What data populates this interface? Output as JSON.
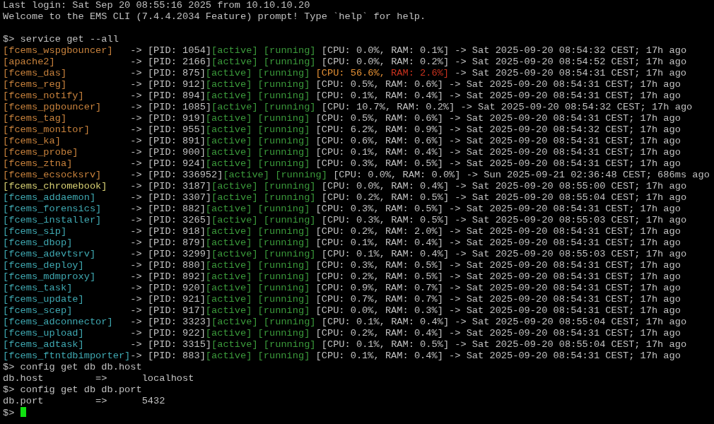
{
  "login_message": "Last login: Sat Sep 20 08:55:16 2025 from 10.10.10.20",
  "welcome_message": "Welcome to the EMS CLI (7.4.4.2034 Feature) prompt! Type `help` for help.",
  "service_command": "$> service get --all",
  "services": [
    {
      "name": "[fcems_wspgbouncer]",
      "color": "#c8823c",
      "arrow": "->",
      "pid": "[PID: 1054]",
      "active": "[active]",
      "running": "[running]",
      "cpu": "[CPU: 0.0%,",
      "ram": "RAM: 0.1%]",
      "cpu_warning": false,
      "ram_critical": false,
      "since": "-> Sat 2025-09-20 08:54:32 CEST; 17h ago"
    },
    {
      "name": "[apache2]",
      "color": "#c8823c",
      "arrow": "->",
      "pid": "[PID: 2166]",
      "active": "[active]",
      "running": "[running]",
      "cpu": "[CPU: 0.0%,",
      "ram": "RAM: 0.2%]",
      "cpu_warning": false,
      "ram_critical": false,
      "since": "-> Sat 2025-09-20 08:54:52 CEST; 17h ago"
    },
    {
      "name": "[fcems_das]",
      "color": "#c8823c",
      "arrow": "->",
      "pid": "[PID: 875]",
      "active": "[active]",
      "running": "[running]",
      "cpu": "[CPU: 56.6%,",
      "ram": "RAM: 2.6%]",
      "cpu_warning": true,
      "ram_critical": true,
      "since": "-> Sat 2025-09-20 08:54:31 CEST; 17h ago"
    },
    {
      "name": "[fcems_reg]",
      "color": "#c8823c",
      "arrow": "->",
      "pid": "[PID: 912]",
      "active": "[active]",
      "running": "[running]",
      "cpu": "[CPU: 0.5%,",
      "ram": "RAM: 0.6%]",
      "cpu_warning": false,
      "ram_critical": false,
      "since": "-> Sat 2025-09-20 08:54:31 CEST; 17h ago"
    },
    {
      "name": "[fcems_notify]",
      "color": "#c8823c",
      "arrow": "->",
      "pid": "[PID: 894]",
      "active": "[active]",
      "running": "[running]",
      "cpu": "[CPU: 0.1%,",
      "ram": "RAM: 0.4%]",
      "cpu_warning": false,
      "ram_critical": false,
      "since": "-> Sat 2025-09-20 08:54:31 CEST; 17h ago"
    },
    {
      "name": "[fcems_pgbouncer]",
      "color": "#c8823c",
      "arrow": "->",
      "pid": "[PID: 1085]",
      "active": "[active]",
      "running": "[running]",
      "cpu": "[CPU: 10.7%,",
      "ram": "RAM: 0.2%]",
      "cpu_warning": false,
      "ram_critical": false,
      "since": "-> Sat 2025-09-20 08:54:32 CEST; 17h ago"
    },
    {
      "name": "[fcems_tag]",
      "color": "#c8823c",
      "arrow": "->",
      "pid": "[PID: 919]",
      "active": "[active]",
      "running": "[running]",
      "cpu": "[CPU: 0.5%,",
      "ram": "RAM: 0.6%]",
      "cpu_warning": false,
      "ram_critical": false,
      "since": "-> Sat 2025-09-20 08:54:31 CEST; 17h ago"
    },
    {
      "name": "[fcems_monitor]",
      "color": "#c8823c",
      "arrow": "->",
      "pid": "[PID: 955]",
      "active": "[active]",
      "running": "[running]",
      "cpu": "[CPU: 6.2%,",
      "ram": "RAM: 0.9%]",
      "cpu_warning": false,
      "ram_critical": false,
      "since": "-> Sat 2025-09-20 08:54:32 CEST; 17h ago"
    },
    {
      "name": "[fcems_ka]",
      "color": "#c8823c",
      "arrow": "->",
      "pid": "[PID: 891]",
      "active": "[active]",
      "running": "[running]",
      "cpu": "[CPU: 0.6%,",
      "ram": "RAM: 0.6%]",
      "cpu_warning": false,
      "ram_critical": false,
      "since": "-> Sat 2025-09-20 08:54:31 CEST; 17h ago"
    },
    {
      "name": "[fcems_probe]",
      "color": "#c8823c",
      "arrow": "->",
      "pid": "[PID: 900]",
      "active": "[active]",
      "running": "[running]",
      "cpu": "[CPU: 0.1%,",
      "ram": "RAM: 0.4%]",
      "cpu_warning": false,
      "ram_critical": false,
      "since": "-> Sat 2025-09-20 08:54:31 CEST; 17h ago"
    },
    {
      "name": "[fcems_ztna]",
      "color": "#c8823c",
      "arrow": "->",
      "pid": "[PID: 924]",
      "active": "[active]",
      "running": "[running]",
      "cpu": "[CPU: 0.3%,",
      "ram": "RAM: 0.5%]",
      "cpu_warning": false,
      "ram_critical": false,
      "since": "-> Sat 2025-09-20 08:54:31 CEST; 17h ago"
    },
    {
      "name": "[fcems_ecsocksrv]",
      "color": "#c8823c",
      "arrow": "->",
      "pid": "[PID: 336952]",
      "active": "[active]",
      "running": "[running]",
      "cpu": "[CPU: 0.0%,",
      "ram": "RAM: 0.0%]",
      "cpu_warning": false,
      "ram_critical": false,
      "since": "-> Sun 2025-09-21 02:36:48 CEST; 686ms ago"
    },
    {
      "name": "[fcems_chromebook]",
      "color": "#d6cf72",
      "arrow": "->",
      "pid": "[PID: 3187]",
      "active": "[active]",
      "running": "[running]",
      "cpu": "[CPU: 0.0%,",
      "ram": "RAM: 0.4%]",
      "cpu_warning": false,
      "ram_critical": false,
      "since": "-> Sat 2025-09-20 08:55:00 CEST; 17h ago"
    },
    {
      "name": "[fcems_addaemon]",
      "color": "#3fa9b2",
      "arrow": "->",
      "pid": "[PID: 3307]",
      "active": "[active]",
      "running": "[running]",
      "cpu": "[CPU: 0.2%,",
      "ram": "RAM: 0.5%]",
      "cpu_warning": false,
      "ram_critical": false,
      "since": "-> Sat 2025-09-20 08:55:04 CEST; 17h ago"
    },
    {
      "name": "[fcems_forensics]",
      "color": "#3fa9b2",
      "arrow": "->",
      "pid": "[PID: 882]",
      "active": "[active]",
      "running": "[running]",
      "cpu": "[CPU: 0.3%,",
      "ram": "RAM: 0.5%]",
      "cpu_warning": false,
      "ram_critical": false,
      "since": "-> Sat 2025-09-20 08:54:31 CEST; 17h ago"
    },
    {
      "name": "[fcems_installer]",
      "color": "#3fa9b2",
      "arrow": "->",
      "pid": "[PID: 3265]",
      "active": "[active]",
      "running": "[running]",
      "cpu": "[CPU: 0.3%,",
      "ram": "RAM: 0.5%]",
      "cpu_warning": false,
      "ram_critical": false,
      "since": "-> Sat 2025-09-20 08:55:03 CEST; 17h ago"
    },
    {
      "name": "[fcems_sip]",
      "color": "#3fa9b2",
      "arrow": "->",
      "pid": "[PID: 918]",
      "active": "[active]",
      "running": "[running]",
      "cpu": "[CPU: 0.2%,",
      "ram": "RAM: 2.0%]",
      "cpu_warning": false,
      "ram_critical": false,
      "since": "-> Sat 2025-09-20 08:54:31 CEST; 17h ago"
    },
    {
      "name": "[fcems_dbop]",
      "color": "#3fa9b2",
      "arrow": "->",
      "pid": "[PID: 879]",
      "active": "[active]",
      "running": "[running]",
      "cpu": "[CPU: 0.1%,",
      "ram": "RAM: 0.4%]",
      "cpu_warning": false,
      "ram_critical": false,
      "since": "-> Sat 2025-09-20 08:54:31 CEST; 17h ago"
    },
    {
      "name": "[fcems_adevtsrv]",
      "color": "#3fa9b2",
      "arrow": "->",
      "pid": "[PID: 3299]",
      "active": "[active]",
      "running": "[running]",
      "cpu": "[CPU: 0.1%,",
      "ram": "RAM: 0.4%]",
      "cpu_warning": false,
      "ram_critical": false,
      "since": "-> Sat 2025-09-20 08:55:03 CEST; 17h ago"
    },
    {
      "name": "[fcems_deploy]",
      "color": "#3fa9b2",
      "arrow": "->",
      "pid": "[PID: 880]",
      "active": "[active]",
      "running": "[running]",
      "cpu": "[CPU: 0.3%,",
      "ram": "RAM: 0.5%]",
      "cpu_warning": false,
      "ram_critical": false,
      "since": "-> Sat 2025-09-20 08:54:31 CEST; 17h ago"
    },
    {
      "name": "[fcems_mdmproxy]",
      "color": "#3fa9b2",
      "arrow": "->",
      "pid": "[PID: 892]",
      "active": "[active]",
      "running": "[running]",
      "cpu": "[CPU: 0.2%,",
      "ram": "RAM: 0.5%]",
      "cpu_warning": false,
      "ram_critical": false,
      "since": "-> Sat 2025-09-20 08:54:31 CEST; 17h ago"
    },
    {
      "name": "[fcems_task]",
      "color": "#3fa9b2",
      "arrow": "->",
      "pid": "[PID: 920]",
      "active": "[active]",
      "running": "[running]",
      "cpu": "[CPU: 0.9%,",
      "ram": "RAM: 0.7%]",
      "cpu_warning": false,
      "ram_critical": false,
      "since": "-> Sat 2025-09-20 08:54:31 CEST; 17h ago"
    },
    {
      "name": "[fcems_update]",
      "color": "#3fa9b2",
      "arrow": "->",
      "pid": "[PID: 921]",
      "active": "[active]",
      "running": "[running]",
      "cpu": "[CPU: 0.7%,",
      "ram": "RAM: 0.7%]",
      "cpu_warning": false,
      "ram_critical": false,
      "since": "-> Sat 2025-09-20 08:54:31 CEST; 17h ago"
    },
    {
      "name": "[fcems_scep]",
      "color": "#3fa9b2",
      "arrow": "->",
      "pid": "[PID: 917]",
      "active": "[active]",
      "running": "[running]",
      "cpu": "[CPU: 0.0%,",
      "ram": "RAM: 0.3%]",
      "cpu_warning": false,
      "ram_critical": false,
      "since": "-> Sat 2025-09-20 08:54:31 CEST; 17h ago"
    },
    {
      "name": "[fcems_adconnector]",
      "color": "#3fa9b2",
      "arrow": "->",
      "pid": "[PID: 3323]",
      "active": "[active]",
      "running": "[running]",
      "cpu": "[CPU: 0.1%,",
      "ram": "RAM: 0.4%]",
      "cpu_warning": false,
      "ram_critical": false,
      "since": "-> Sat 2025-09-20 08:55:04 CEST; 17h ago"
    },
    {
      "name": "[fcems_upload]",
      "color": "#3fa9b2",
      "arrow": "->",
      "pid": "[PID: 922]",
      "active": "[active]",
      "running": "[running]",
      "cpu": "[CPU: 0.2%,",
      "ram": "RAM: 0.4%]",
      "cpu_warning": false,
      "ram_critical": false,
      "since": "-> Sat 2025-09-20 08:54:31 CEST; 17h ago"
    },
    {
      "name": "[fcems_adtask]",
      "color": "#3fa9b2",
      "arrow": "->",
      "pid": "[PID: 3315]",
      "active": "[active]",
      "running": "[running]",
      "cpu": "[CPU: 0.1%,",
      "ram": "RAM: 0.5%]",
      "cpu_warning": false,
      "ram_critical": false,
      "since": "-> Sat 2025-09-20 08:55:04 CEST; 17h ago"
    },
    {
      "name": "[fcems_ftntdbimporter]",
      "color": "#3fa9b2",
      "arrow": "->",
      "pid": "[PID: 883]",
      "active": "[active]",
      "running": "[running]",
      "cpu": "[CPU: 0.1%,",
      "ram": "RAM: 0.4%]",
      "cpu_warning": false,
      "ram_critical": false,
      "since": "-> Sat 2025-09-20 08:54:31 CEST; 17h ago"
    }
  ],
  "config_queries": [
    {
      "command": "$> config get db db.host",
      "key": "db.host",
      "arrow": "=>",
      "value": "localhost"
    },
    {
      "command": "$> config get db db.port",
      "key": "db.port",
      "arrow": "=>",
      "value": "5432"
    }
  ],
  "input_prompt": "$>"
}
